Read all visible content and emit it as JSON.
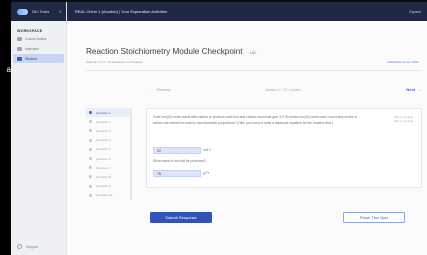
{
  "edge_letter": "a",
  "sidebar": {
    "brand": "OLI Torus",
    "collapse_icon": "close-icon",
    "section": "WORKSPACE",
    "items": [
      {
        "label": "Course Author",
        "icon": "pen-icon",
        "active": false
      },
      {
        "label": "Instructor",
        "icon": "teacher-icon",
        "active": false
      },
      {
        "label": "Student",
        "icon": "student-icon",
        "active": true
      }
    ],
    "support": "Support"
  },
  "topbar": {
    "title": "REAL Chem 1 (Arnablo) | Your Exploration Activities",
    "right": "Expand"
  },
  "page": {
    "title": "Reaction Stoichiometry Module Checkpoint",
    "badge": "182",
    "breadcrumb": "Attempt 1 of 3 • 13 questions • In Progress",
    "hide_link": "Hide/Show Ignore Table"
  },
  "nav": {
    "prev": "Previous",
    "question_counter": "Question 1 / 13 • 4 points",
    "next": "Next"
  },
  "questions": [
    "Question 1",
    "Question 2",
    "Question 3",
    "Question 4",
    "Question 5",
    "Question 6",
    "Question 7",
    "Question 8",
    "Question 9",
    "Question 10"
  ],
  "card": {
    "text": "Solid iron(III) oxide reacts with carbon to produce solid iron and carbon monoxide gas. If 2.50 moles iron(III) oxide react, how many moles of carbon are needed to react in stoichiometric proportions? (Hint: you need to write a balanced equation for the reaction first.)",
    "points_line1": "Part 1: 2 points",
    "points_line2": "Part 2: 2 points",
    "answer1": "22",
    "unit1": "mol C",
    "sub_question": "What mass of iron will be produced?",
    "answer2": "78",
    "unit2": "g Fe"
  },
  "buttons": {
    "submit": "Submit Response",
    "finish": "Finish This Quiz"
  }
}
